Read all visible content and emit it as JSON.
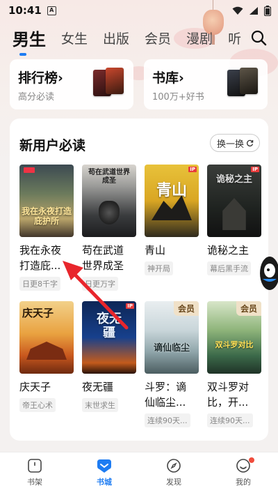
{
  "status": {
    "time": "10:41",
    "app_icon_letter": "A"
  },
  "nav": {
    "tabs": [
      {
        "label": "男生",
        "active": true
      },
      {
        "label": "女生",
        "active": false
      },
      {
        "label": "出版",
        "active": false
      },
      {
        "label": "会员",
        "active": false
      },
      {
        "label": "漫剧",
        "active": false
      },
      {
        "label": "听",
        "active": false
      }
    ],
    "accent": "#1e7cf2"
  },
  "top_cards": [
    {
      "title": "排行榜",
      "chevron": "›",
      "subtitle": "高分必读"
    },
    {
      "title": "书库",
      "chevron": "›",
      "subtitle": "100万+好书"
    }
  ],
  "section": {
    "title": "新用户必读",
    "refresh_label": "换一换",
    "books": [
      {
        "title_line1": "我在永夜",
        "title_line2": "打造庇...",
        "tag": "日更8千字",
        "cover_text": "我在永夜打造庇护所",
        "vip": ""
      },
      {
        "title_line1": "苟在武道",
        "title_line2": "世界成圣",
        "tag": "日更万字",
        "cover_text": "苟在武道世界成圣",
        "vip": ""
      },
      {
        "title_line1": "青山",
        "title_line2": "",
        "tag": "神开局",
        "cover_text": "青山",
        "vip": ""
      },
      {
        "title_line1": "诡秘之主",
        "title_line2": "",
        "tag": "幕后黑手流",
        "cover_text": "诡秘之主",
        "vip": ""
      },
      {
        "title_line1": "庆天子",
        "title_line2": "",
        "tag": "帝王心术",
        "cover_text": "庆天子",
        "vip": ""
      },
      {
        "title_line1": "夜无疆",
        "title_line2": "",
        "tag": "末世求生",
        "cover_text": "夜无疆",
        "vip": ""
      },
      {
        "title_line1": "斗罗：谪",
        "title_line2": "仙临尘...",
        "tag": "连续90天...",
        "cover_text": "谪仙临尘",
        "vip": "会员"
      },
      {
        "title_line1": "双斗罗对",
        "title_line2": "比，开...",
        "tag": "连续90天...",
        "cover_text": "双斗罗对比",
        "vip": "会员"
      }
    ]
  },
  "bottom_nav": [
    {
      "label": "书架",
      "active": false
    },
    {
      "label": "书城",
      "active": true
    },
    {
      "label": "发现",
      "active": false
    },
    {
      "label": "我的",
      "active": false
    }
  ],
  "arrow_color": "#e8262c"
}
